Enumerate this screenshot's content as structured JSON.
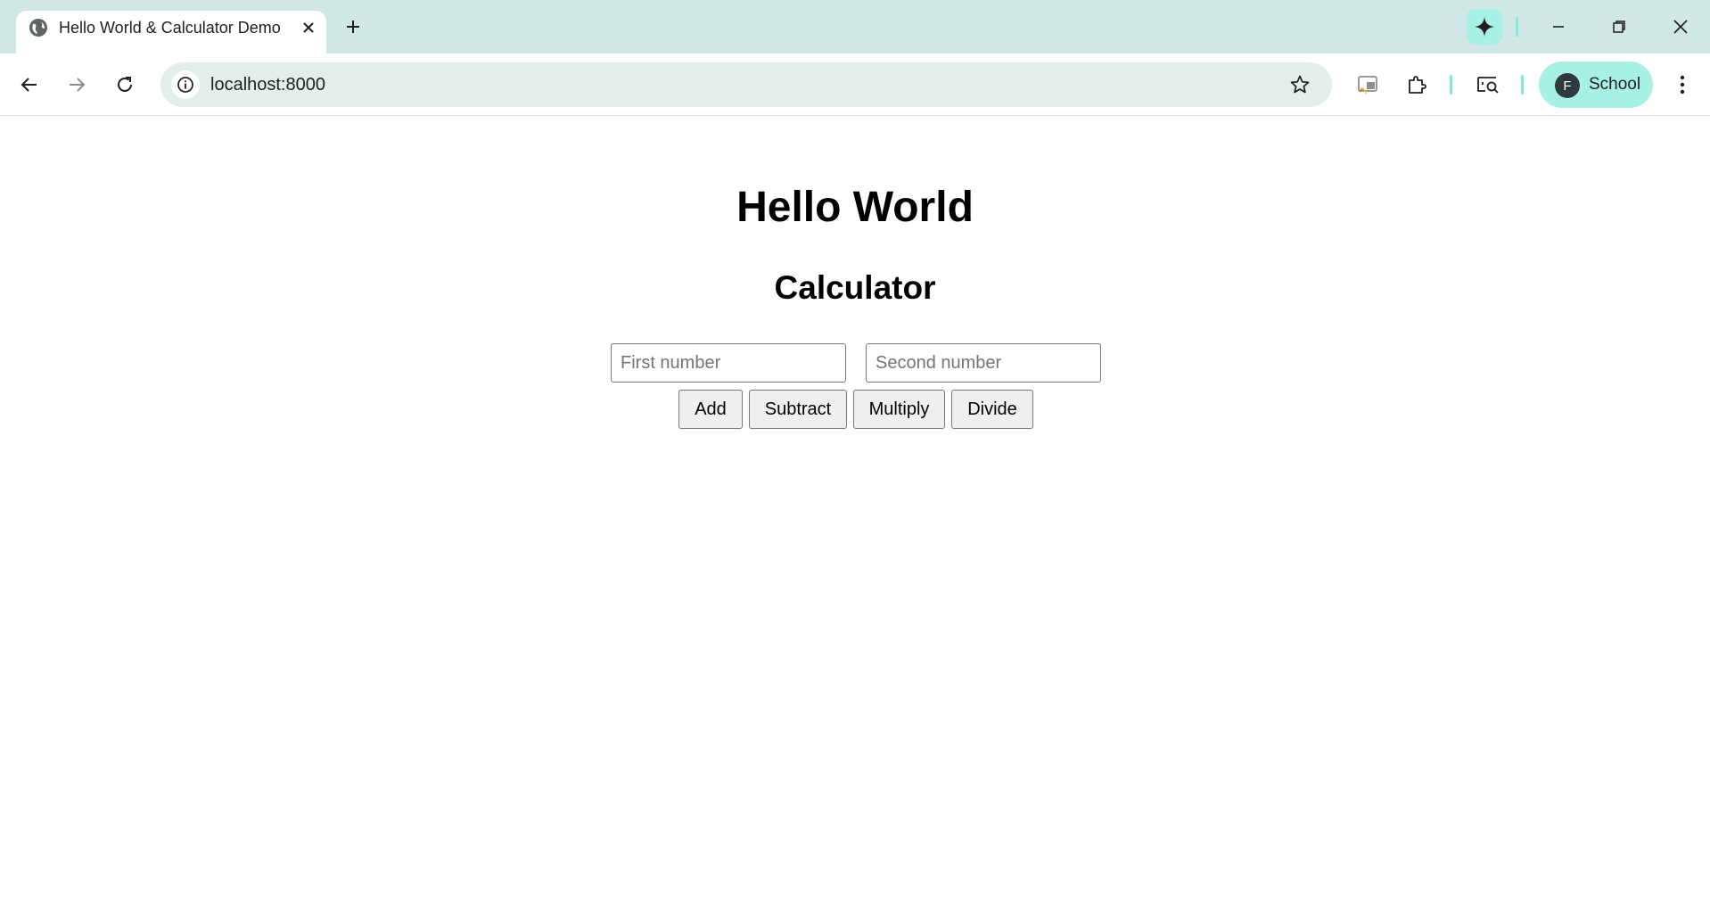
{
  "browser": {
    "tab_title": "Hello World & Calculator Demo",
    "url": "localhost:8000",
    "profile": {
      "initial": "F",
      "label": "School"
    },
    "accent_color": "#a6f0e4",
    "frame_color": "#cfe7e5"
  },
  "page": {
    "heading": "Hello World",
    "subheading": "Calculator",
    "inputs": {
      "first_placeholder": "First number",
      "second_placeholder": "Second number"
    },
    "buttons": {
      "add": "Add",
      "subtract": "Subtract",
      "multiply": "Multiply",
      "divide": "Divide"
    }
  }
}
